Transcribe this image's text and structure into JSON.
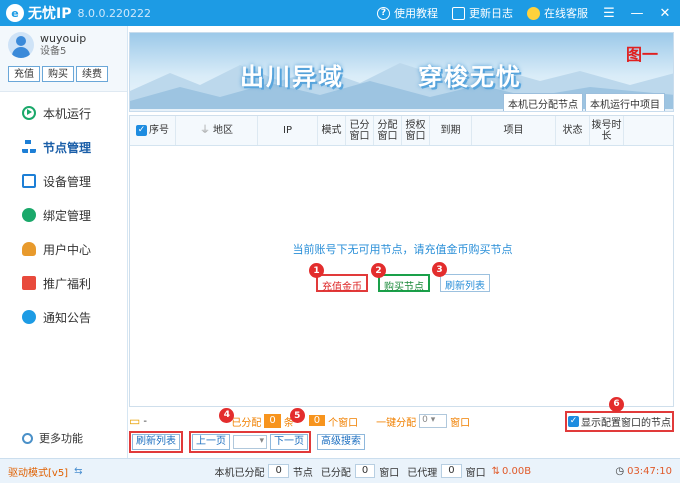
{
  "app": {
    "title": "无忧IP",
    "version": "8.0.0.220222",
    "logo_text": "IP"
  },
  "titlebar": {
    "tutorial": "使用教程",
    "changelog": "更新日志",
    "support": "在线客服"
  },
  "user": {
    "name": "wuyouip",
    "device": "设备5",
    "recharge": "充值",
    "buy": "购买",
    "renew": "续费"
  },
  "sidebar": {
    "items": [
      {
        "label": "本机运行",
        "icon": "play-icon"
      },
      {
        "label": "节点管理",
        "icon": "tree-icon"
      },
      {
        "label": "设备管理",
        "icon": "device-icon"
      },
      {
        "label": "绑定管理",
        "icon": "bind-icon"
      },
      {
        "label": "用户中心",
        "icon": "user-icon"
      },
      {
        "label": "推广福利",
        "icon": "gift-icon"
      },
      {
        "label": "通知公告",
        "icon": "bell-icon"
      }
    ],
    "more": "更多功能"
  },
  "banner": {
    "text1": "出川异域",
    "text2": "穿梭无忧",
    "tag": "图一",
    "tab1": "本机已分配节点",
    "tab2": "本机运行中项目"
  },
  "table": {
    "headers": [
      "序号",
      "地区",
      "IP",
      "模式",
      "已分窗口",
      "分配窗口",
      "授权窗口",
      "到期",
      "项目",
      "状态",
      "拨号时长"
    ],
    "empty_message": "当前账号下无可用节点，请充值金币购买节点"
  },
  "actions": {
    "recharge_coins": "充值金币",
    "buy_nodes": "购买节点",
    "refresh_list": "刷新列表",
    "badges": [
      "1",
      "2",
      "3",
      "4",
      "5",
      "6"
    ]
  },
  "stats": {
    "dash": "-",
    "allocated_label": "已分配",
    "allocated_value": "0",
    "items_label": "条",
    "windows_value": "0",
    "windows_label": "个窗口",
    "quick_alloc": "一键分配",
    "quick_alloc_value": "0",
    "window_unit": "窗口",
    "show_config": "显示配置窗口的节点"
  },
  "pager": {
    "refresh": "刷新列表",
    "prev": "上一页",
    "next": "下一页",
    "advanced": "高级搜索"
  },
  "statusbar": {
    "mode": "驱动模式[v5]",
    "local_alloc": "本机已分配",
    "local_alloc_value": "0",
    "node_unit": "节点",
    "allocated": "已分配",
    "allocated_value": "0",
    "window_unit": "窗口",
    "proxied": "已代理",
    "proxied_value": "0",
    "proxied_unit": "窗口",
    "traffic": "0.00B",
    "time": "03:47:10"
  }
}
